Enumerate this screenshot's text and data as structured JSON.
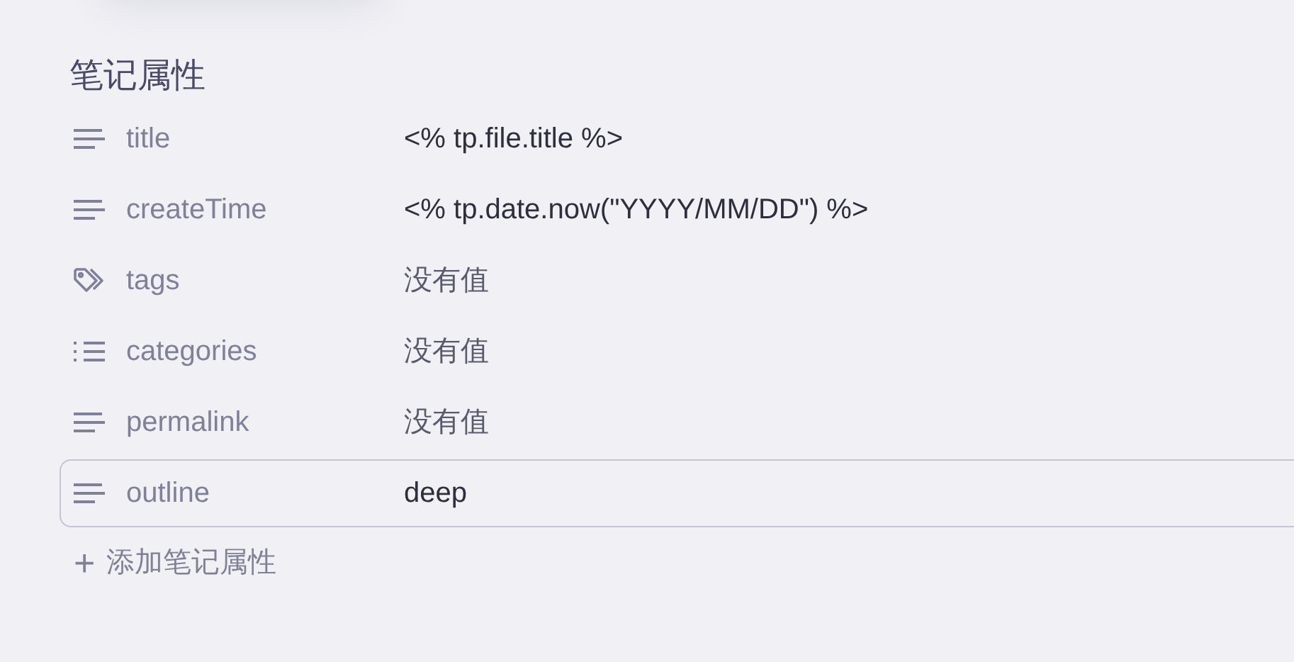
{
  "heading": "笔记属性",
  "properties": [
    {
      "kind": "text",
      "key": "title",
      "value": "<% tp.file.title %>",
      "empty": false,
      "selected": false
    },
    {
      "kind": "text",
      "key": "createTime",
      "value": "<% tp.date.now(\"YYYY/MM/DD\") %>",
      "empty": false,
      "selected": false
    },
    {
      "kind": "tags",
      "key": "tags",
      "value": "没有值",
      "empty": true,
      "selected": false
    },
    {
      "kind": "list",
      "key": "categories",
      "value": "没有值",
      "empty": true,
      "selected": false
    },
    {
      "kind": "text",
      "key": "permalink",
      "value": "没有值",
      "empty": true,
      "selected": false
    },
    {
      "kind": "text",
      "key": "outline",
      "value": "deep",
      "empty": false,
      "selected": true
    }
  ],
  "add_button": {
    "icon": "+",
    "label": "添加笔记属性"
  }
}
